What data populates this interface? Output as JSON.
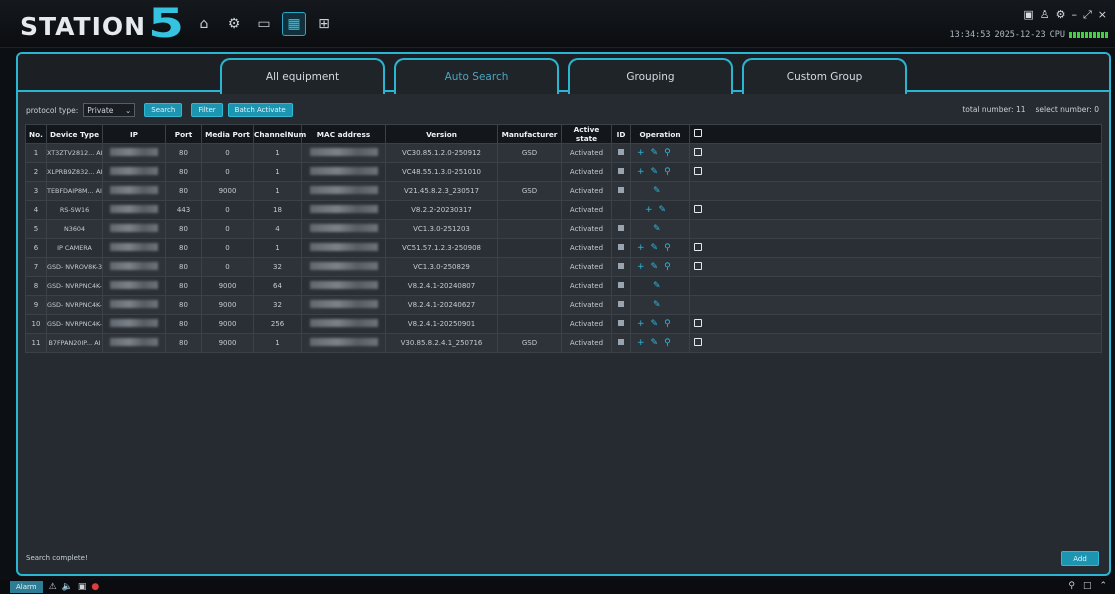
{
  "app": {
    "logo_text": "STATION",
    "logo_number": "5"
  },
  "topnav": {
    "home_icon": "⌂",
    "settings_icon": "⚙",
    "camera_icon": "▭",
    "devices_icon": "▦",
    "grid_icon": "⊞"
  },
  "window_controls": [
    "▣",
    "♙",
    "⚙",
    "–",
    "⤢",
    "×"
  ],
  "clock": {
    "time": "13:34:53",
    "date": "2025-12-23",
    "cpu_label": "CPU"
  },
  "tabs": [
    {
      "label": "All equipment"
    },
    {
      "label": "Auto Search"
    },
    {
      "label": "Grouping"
    },
    {
      "label": "Custom Group"
    }
  ],
  "toolbar": {
    "protocol_label": "protocol type:",
    "protocol_value": "Private",
    "search_label": "Search",
    "filter_label": "Filter",
    "batch_label": "Batch Activate",
    "total_label": "total number:",
    "total_value": "11",
    "select_label": "select number:",
    "select_value": "0"
  },
  "columns": [
    "No.",
    "Device Type",
    "IP",
    "Port",
    "Media Port",
    "ChannelNum",
    "MAC address",
    "Version",
    "Manufacturer",
    "Active state",
    "ID",
    "Operation"
  ],
  "rows": [
    {
      "no": "1",
      "type": "XT3ZTV2812... AI",
      "port": "80",
      "media": "0",
      "ch": "1",
      "version": "VC30.85.1.2.0-250912",
      "mfr": "GSD",
      "state": "Activated",
      "id": true,
      "ops": [
        "+",
        "✎",
        "⚲"
      ],
      "chk": true
    },
    {
      "no": "2",
      "type": "XLPRB9Z832... AI",
      "port": "80",
      "media": "0",
      "ch": "1",
      "version": "VC48.55.1.3.0-251010",
      "mfr": "",
      "state": "Activated",
      "id": true,
      "ops": [
        "+",
        "✎",
        "⚲"
      ],
      "chk": true
    },
    {
      "no": "3",
      "type": "TEBFDAIP8M... AI",
      "port": "80",
      "media": "9000",
      "ch": "1",
      "version": "V21.45.8.2.3_230517",
      "mfr": "GSD",
      "state": "Activated",
      "id": true,
      "ops": [
        "✎"
      ],
      "chk": false
    },
    {
      "no": "4",
      "type": "RS-SW16",
      "port": "443",
      "media": "0",
      "ch": "18",
      "version": "V8.2.2-20230317",
      "mfr": "",
      "state": "Activated",
      "id": false,
      "ops": [
        "+",
        "✎"
      ],
      "chk": true
    },
    {
      "no": "5",
      "type": "N3604",
      "port": "80",
      "media": "0",
      "ch": "4",
      "version": "VC1.3.0-251203",
      "mfr": "",
      "state": "Activated",
      "id": true,
      "ops": [
        "✎"
      ],
      "chk": false
    },
    {
      "no": "6",
      "type": "IP CAMERA",
      "port": "80",
      "media": "0",
      "ch": "1",
      "version": "VC51.57.1.2.3-250908",
      "mfr": "",
      "state": "Activated",
      "id": true,
      "ops": [
        "+",
        "✎",
        "⚲"
      ],
      "chk": true
    },
    {
      "no": "7",
      "type": "GSD- NVROV8K-32...",
      "port": "80",
      "media": "0",
      "ch": "32",
      "version": "VC1.3.0-250829",
      "mfr": "",
      "state": "Activated",
      "id": true,
      "ops": [
        "+",
        "✎",
        "⚲"
      ],
      "chk": true
    },
    {
      "no": "8",
      "type": "GSD- NVRPNC4K-6...",
      "port": "80",
      "media": "9000",
      "ch": "64",
      "version": "V8.2.4.1-20240807",
      "mfr": "",
      "state": "Activated",
      "id": true,
      "ops": [
        "✎"
      ],
      "chk": false
    },
    {
      "no": "9",
      "type": "GSD- NVRPNC4K-3...",
      "port": "80",
      "media": "9000",
      "ch": "32",
      "version": "V8.2.4.1-20240627",
      "mfr": "",
      "state": "Activated",
      "id": true,
      "ops": [
        "✎"
      ],
      "chk": false
    },
    {
      "no": "10",
      "type": "GSD- NVRPNC4K-2...",
      "port": "80",
      "media": "9000",
      "ch": "256",
      "version": "V8.2.4.1-20250901",
      "mfr": "",
      "state": "Activated",
      "id": true,
      "ops": [
        "+",
        "✎",
        "⚲"
      ],
      "chk": true
    },
    {
      "no": "11",
      "type": "B7FPAN20IP... AI",
      "port": "80",
      "media": "9000",
      "ch": "1",
      "version": "V30.85.8.2.4.1_250716",
      "mfr": "GSD",
      "state": "Activated",
      "id": true,
      "ops": [
        "+",
        "✎",
        "⚲"
      ],
      "chk": true
    }
  ],
  "status_text": "Search complete!",
  "add_label": "Add",
  "bottombar": {
    "alarm_label": "Alarm",
    "icons": [
      "⚠",
      "🔈",
      "▣"
    ],
    "right_icons": [
      "⚲",
      "□",
      "⌃"
    ]
  },
  "colors": {
    "accent": "#2ab6d3",
    "button": "#1d94b0",
    "background": "#262b31"
  }
}
